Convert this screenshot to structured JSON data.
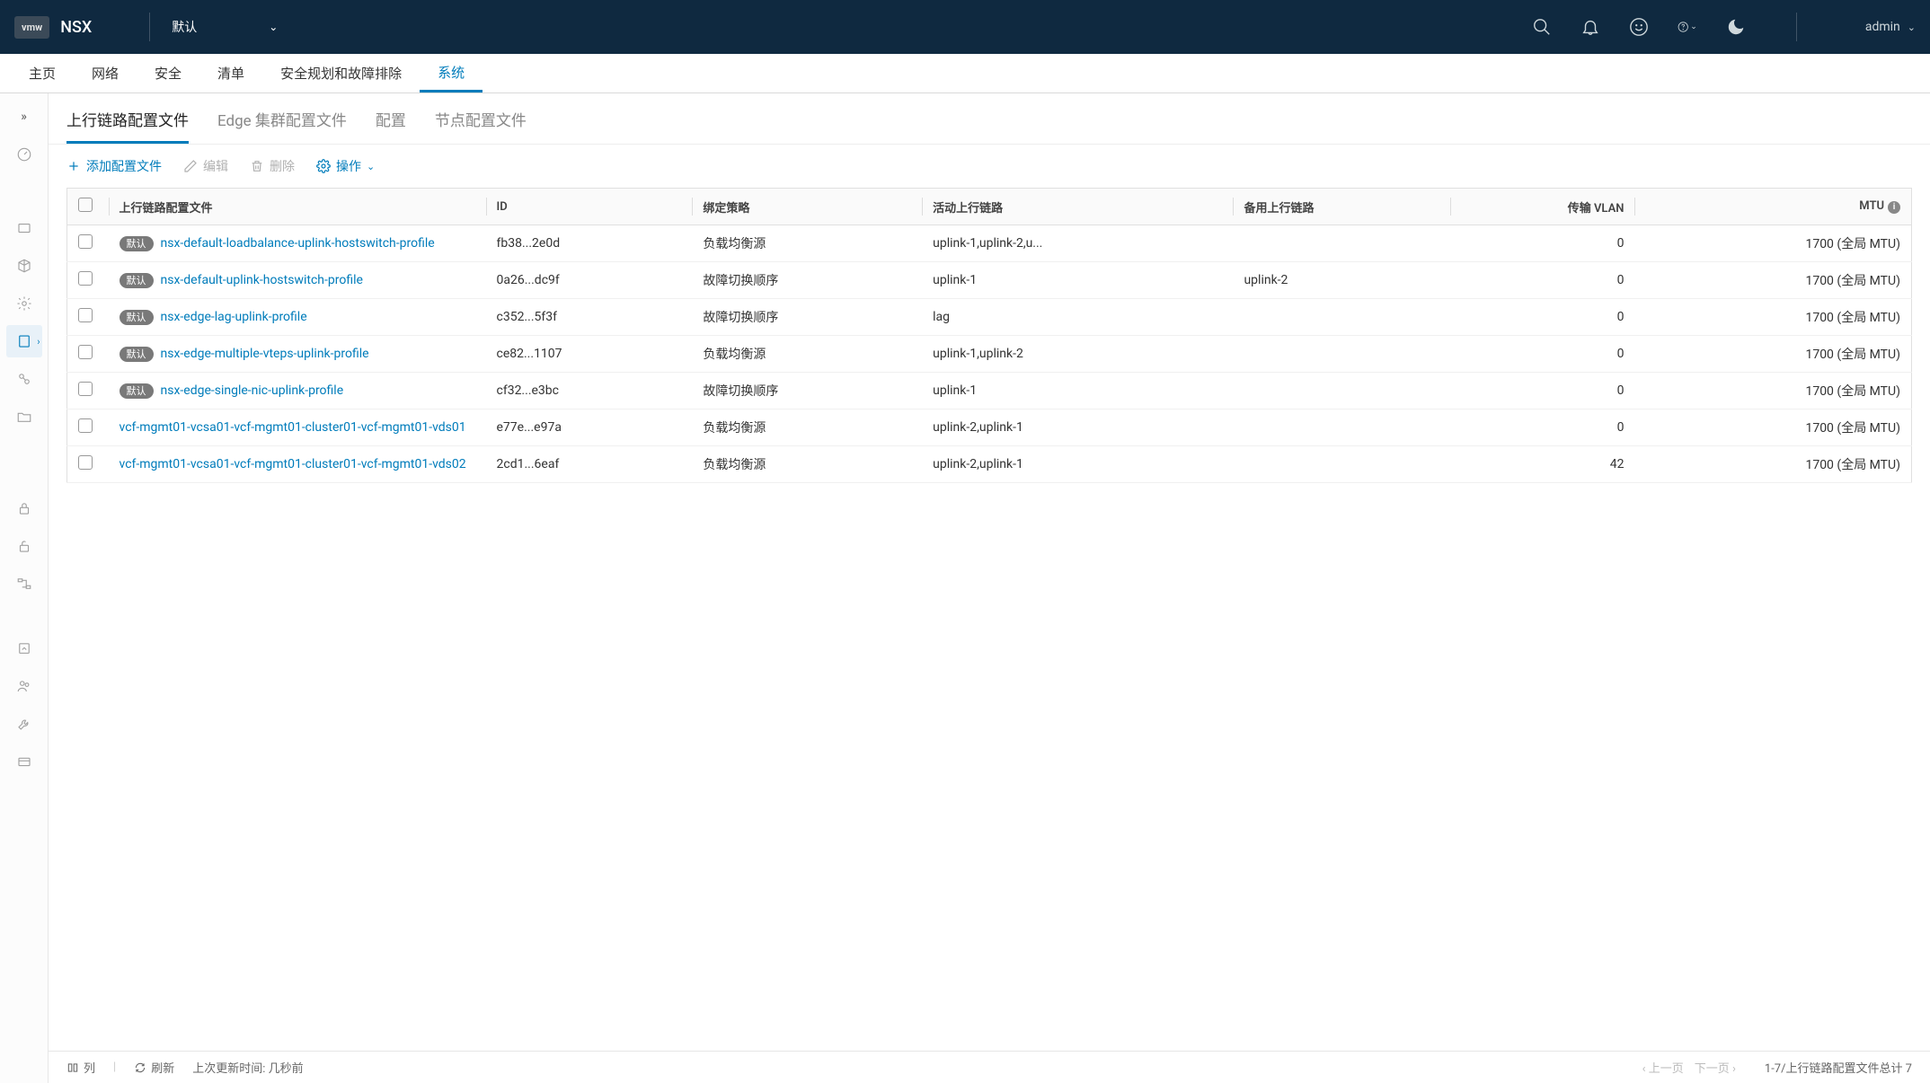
{
  "header": {
    "logo": "vmw",
    "product": "NSX",
    "tenant": "默认",
    "user": "admin"
  },
  "nav": {
    "items": [
      "主页",
      "网络",
      "安全",
      "清单",
      "安全规划和故障排除",
      "系统"
    ],
    "active_index": 5
  },
  "subtabs": {
    "items": [
      "上行链路配置文件",
      "Edge 集群配置文件",
      "配置",
      "节点配置文件"
    ],
    "active_index": 0
  },
  "toolbar": {
    "add": "添加配置文件",
    "edit": "编辑",
    "delete": "删除",
    "actions": "操作"
  },
  "table": {
    "headers": {
      "name": "上行链路配置文件",
      "id": "ID",
      "policy": "绑定策略",
      "active": "活动上行链路",
      "standby": "备用上行链路",
      "vlan": "传输 VLAN",
      "mtu": "MTU"
    },
    "default_badge": "默认",
    "rows": [
      {
        "default": true,
        "name": "nsx-default-loadbalance-uplink-hostswitch-profile",
        "id": "fb38...2e0d",
        "policy": "负载均衡源",
        "active": "uplink-1,uplink-2,u...",
        "standby": "",
        "vlan": "0",
        "mtu": "1700 (全局 MTU)"
      },
      {
        "default": true,
        "name": "nsx-default-uplink-hostswitch-profile",
        "id": "0a26...dc9f",
        "policy": "故障切换顺序",
        "active": "uplink-1",
        "standby": "uplink-2",
        "vlan": "0",
        "mtu": "1700 (全局 MTU)"
      },
      {
        "default": true,
        "name": "nsx-edge-lag-uplink-profile",
        "id": "c352...5f3f",
        "policy": "故障切换顺序",
        "active": "lag",
        "standby": "",
        "vlan": "0",
        "mtu": "1700 (全局 MTU)"
      },
      {
        "default": true,
        "name": "nsx-edge-multiple-vteps-uplink-profile",
        "id": "ce82...1107",
        "policy": "负载均衡源",
        "active": "uplink-1,uplink-2",
        "standby": "",
        "vlan": "0",
        "mtu": "1700 (全局 MTU)"
      },
      {
        "default": true,
        "name": "nsx-edge-single-nic-uplink-profile",
        "id": "cf32...e3bc",
        "policy": "故障切换顺序",
        "active": "uplink-1",
        "standby": "",
        "vlan": "0",
        "mtu": "1700 (全局 MTU)"
      },
      {
        "default": false,
        "name": "vcf-mgmt01-vcsa01-vcf-mgmt01-cluster01-vcf-mgmt01-vds01",
        "id": "e77e...e97a",
        "policy": "负载均衡源",
        "active": "uplink-2,uplink-1",
        "standby": "",
        "vlan": "0",
        "mtu": "1700 (全局 MTU)"
      },
      {
        "default": false,
        "name": "vcf-mgmt01-vcsa01-vcf-mgmt01-cluster01-vcf-mgmt01-vds02",
        "id": "2cd1...6eaf",
        "policy": "负载均衡源",
        "active": "uplink-2,uplink-1",
        "standby": "",
        "vlan": "42",
        "mtu": "1700 (全局 MTU)"
      }
    ]
  },
  "footer": {
    "columns": "列",
    "refresh": "刷新",
    "updated_label": "上次更新时间:",
    "updated_value": "几秒前",
    "prev": "上一页",
    "next": "下一页",
    "summary": "1-7/上行链路配置文件总计 7"
  }
}
